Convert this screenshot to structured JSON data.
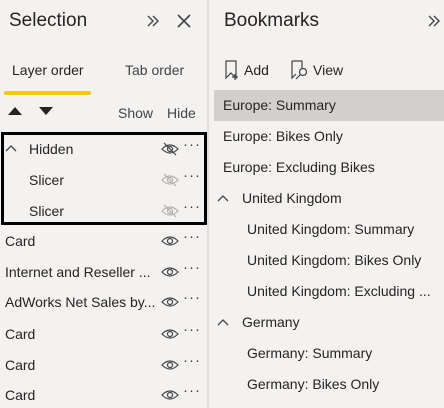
{
  "selection": {
    "title": "Selection",
    "tabs": [
      {
        "label": "Layer order"
      },
      {
        "label": "Tab order"
      }
    ],
    "show_label": "Show",
    "hide_label": "Hide",
    "group": {
      "label": "Hidden",
      "children": [
        {
          "label": "Slicer"
        },
        {
          "label": "Slicer"
        }
      ]
    },
    "items": [
      {
        "label": "Card"
      },
      {
        "label": "Internet and Reseller ..."
      },
      {
        "label": "AdWorks Net Sales by..."
      },
      {
        "label": "Card"
      },
      {
        "label": "Card"
      },
      {
        "label": "Card"
      }
    ],
    "more_label": "···"
  },
  "bookmarks": {
    "title": "Bookmarks",
    "add_label": "Add",
    "view_label": "View",
    "items": [
      {
        "label": "Europe: Summary"
      },
      {
        "label": "Europe: Bikes Only"
      },
      {
        "label": "Europe: Excluding Bikes"
      },
      {
        "label": "United Kingdom"
      },
      {
        "label": "United Kingdom: Summary"
      },
      {
        "label": "United Kingdom: Bikes Only"
      },
      {
        "label": "United Kingdom: Excluding ..."
      },
      {
        "label": "Germany"
      },
      {
        "label": "Germany: Summary"
      },
      {
        "label": "Germany: Bikes Only"
      }
    ]
  },
  "colors": {
    "accent": "#f2c811",
    "selected_bg": "#d2d0ce"
  },
  "icons": [
    "expand-icon",
    "close-icon",
    "move-up-icon",
    "move-down-icon",
    "chevron-up-icon",
    "eye-hidden-icon",
    "eye-icon",
    "bookmark-add-icon",
    "view-icon"
  ]
}
